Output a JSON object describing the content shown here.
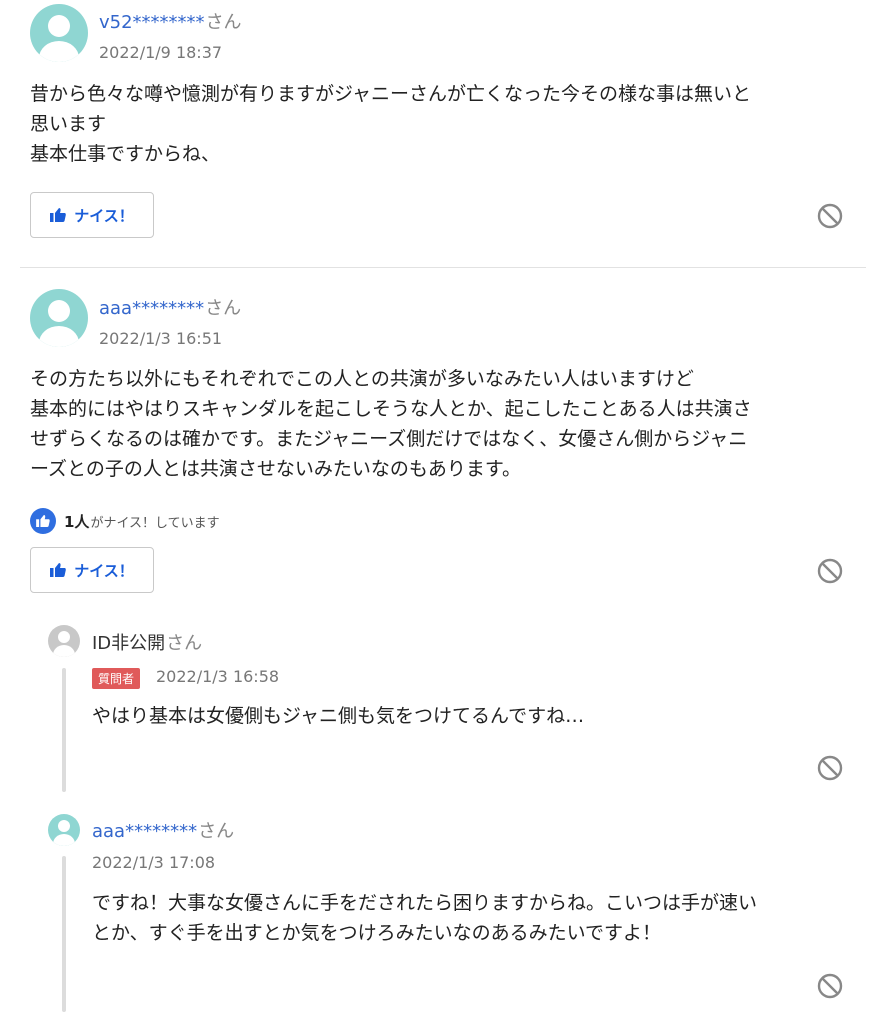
{
  "nice_label": "ナイス！",
  "san": "さん",
  "answers": [
    {
      "username": "v52********",
      "date": "2022/1/9 18:37",
      "text": "昔から色々な噂や憶測が有りますがジャニーさんが亡くなった今その様な事は無いと\n思います\n基本仕事ですからね、"
    },
    {
      "username": "aaa********",
      "date": "2022/1/3 16:51",
      "text": "その方たち以外にもそれぞれでこの人との共演が多いなみたい人はいますけど\n基本的にはやはりスキャンダルを起こしそうな人とか、起こしたことある人は共演さ\nせずらくなるのは確かです。またジャニーズ側だけではなく、女優さん側からジャニ\nーズとの子の人とは共演させないみたいなのもあります。",
      "nice_count": "1人",
      "nice_suffix": "がナイス！しています",
      "replies": [
        {
          "username": "ID非公開",
          "badge": "質問者",
          "date": "2022/1/3 16:58",
          "text": "やはり基本は女優側もジャニ側も気をつけてるんですね…"
        },
        {
          "username": "aaa********",
          "date": "2022/1/3 17:08",
          "text": "ですね！大事な女優さんに手をだされたら困りますからね。こいつは手が速い\nとか、すぐ手を出すとか気をつけろみたいなのあるみたいですよ！"
        }
      ]
    }
  ],
  "colors": {
    "link_blue": "#3366cc",
    "avatar_teal": "#8fd6d2",
    "avatar_gray": "#c8c8c8",
    "badge_red": "#e05a5a",
    "nice_blue": "#2f6ee0"
  },
  "icons": [
    "user-avatar-icon",
    "thumbs-up-icon",
    "ban-icon"
  ]
}
